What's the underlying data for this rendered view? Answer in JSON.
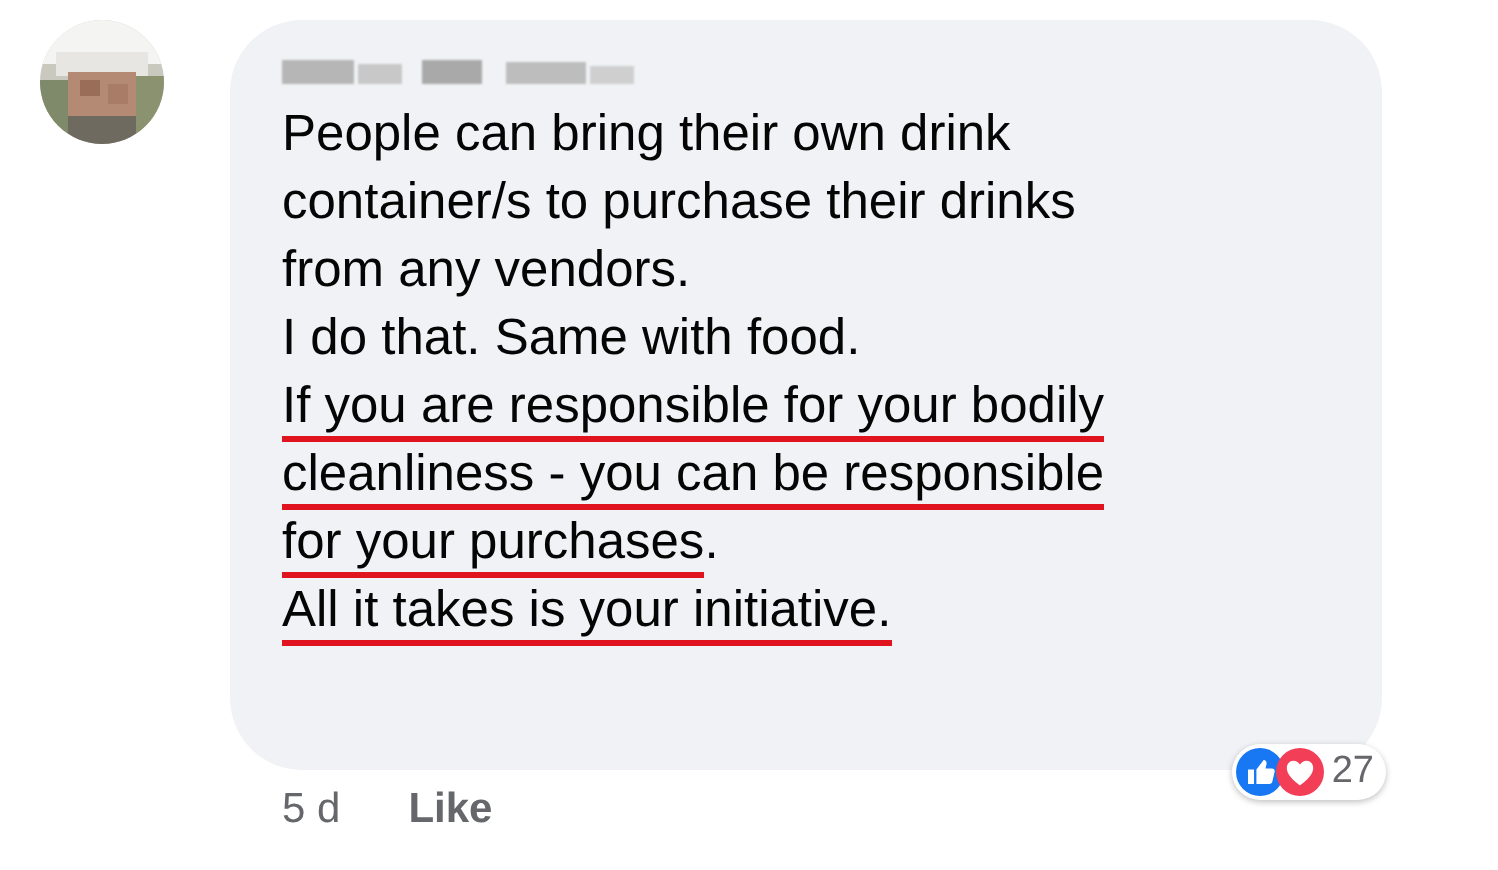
{
  "comment": {
    "lines": [
      {
        "spans": [
          {
            "text": "People can bring their own drink",
            "underlined": false
          }
        ]
      },
      {
        "spans": [
          {
            "text": "container/s to purchase their drinks",
            "underlined": false
          }
        ]
      },
      {
        "spans": [
          {
            "text": "from any vendors.",
            "underlined": false
          }
        ]
      },
      {
        "spans": [
          {
            "text": "I do that. Same with food.",
            "underlined": false
          }
        ]
      },
      {
        "spans": [
          {
            "text": "If you are responsible for your bodily",
            "underlined": true
          }
        ]
      },
      {
        "spans": [
          {
            "text": "cleanliness - you can be responsible",
            "underlined": true
          }
        ]
      },
      {
        "spans": [
          {
            "text": "for your purchases",
            "underlined": true
          },
          {
            "text": ".",
            "underlined": false
          }
        ]
      },
      {
        "spans": [
          {
            "text": "All it takes is your initiative.",
            "underlined": true
          }
        ]
      }
    ],
    "time": "5 d",
    "like": "Like",
    "reactions": {
      "count": "27"
    }
  }
}
